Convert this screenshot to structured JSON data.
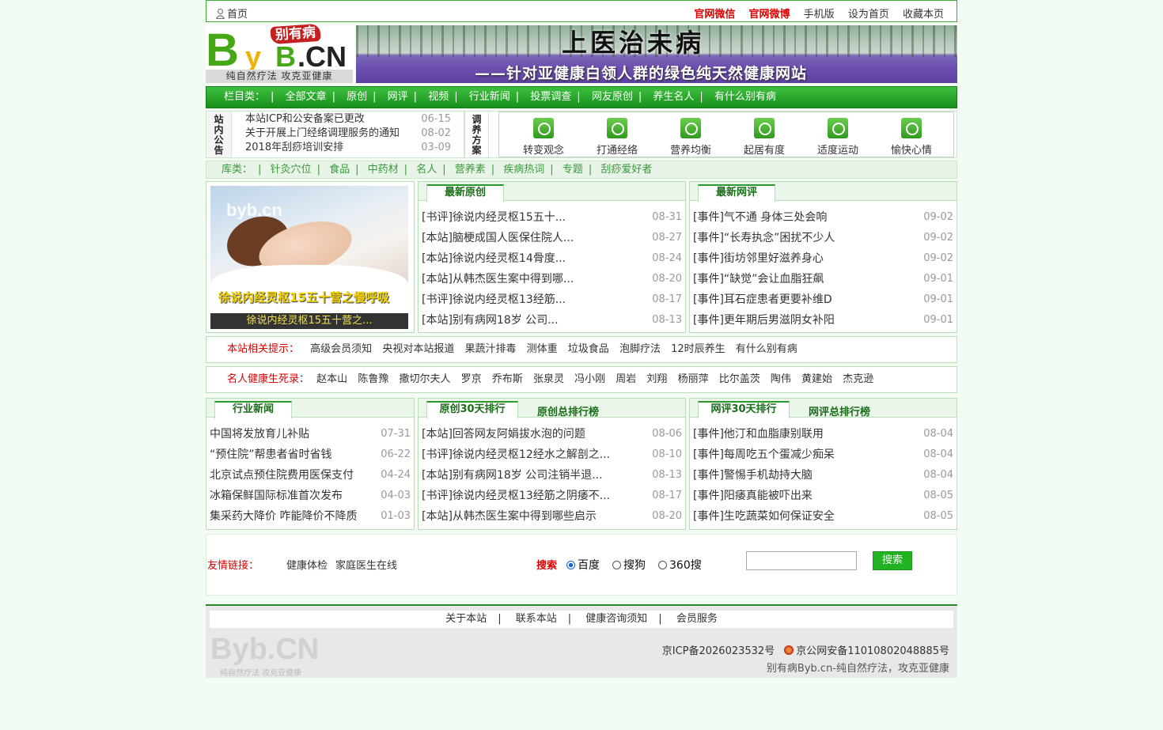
{
  "topbar": {
    "home": "首页",
    "links": [
      "官网微信",
      "官网微博",
      "手机版",
      "设为首页",
      "收藏本页"
    ]
  },
  "logo": {
    "b": "B",
    "y": "y",
    "b2": "B",
    "cn": ".CN",
    "calligraphy": "别有病",
    "slogan": "纯自然疗法 攻克亚健康"
  },
  "banner": {
    "title": "上医治未病",
    "subtitle": "——针对亚健康白领人群的绿色纯天然健康网站"
  },
  "nav": {
    "label": "栏目类：",
    "items": [
      "全部文章",
      "原创",
      "网评",
      "视频",
      "行业新闻",
      "投票调查",
      "网友原创",
      "养生名人",
      "有什么别有病"
    ]
  },
  "notice": {
    "label": "站内公告",
    "items": [
      {
        "title": "本站ICP和公安备案已更改",
        "date": "06-15"
      },
      {
        "title": "关于开展上门经络调理服务的通知",
        "date": "08-02"
      },
      {
        "title": "2018年刮痧培训安排",
        "date": "03-09"
      }
    ]
  },
  "plan": {
    "label": "调养方案",
    "items": [
      "转变观念",
      "打通经络",
      "营养均衡",
      "起居有度",
      "适度运动",
      "愉快心情"
    ]
  },
  "library": {
    "label": "库类：",
    "items": [
      "针灸穴位",
      "食品",
      "中药材",
      "名人",
      "营养素",
      "疾病热词",
      "专题",
      "刮痧爱好者"
    ]
  },
  "featured": {
    "watermark": "byb.cn",
    "image_caption": "徐说内经灵枢15五十营之慢呼吸",
    "title": "徐说内经灵枢15五十营之..."
  },
  "latest_original": {
    "tab": "最新原创",
    "items": [
      {
        "title": "[书评]徐说内经灵枢15五十...",
        "date": "08-31"
      },
      {
        "title": "[本站]脑梗成国人医保住院人...",
        "date": "08-27"
      },
      {
        "title": "[本站]徐说内经灵枢14骨度...",
        "date": "08-24"
      },
      {
        "title": "[本站]从韩杰医生案中得到哪...",
        "date": "08-20"
      },
      {
        "title": "[书评]徐说内经灵枢13经筋...",
        "date": "08-17"
      },
      {
        "title": "[本站]别有病网18岁 公司...",
        "date": "08-13"
      }
    ]
  },
  "latest_review": {
    "tab": "最新网评",
    "items": [
      {
        "title": "[事件]气不通 身体三处会响",
        "date": "09-02"
      },
      {
        "title": "[事件]“长寿执念”困扰不少人",
        "date": "09-02"
      },
      {
        "title": "[事件]街坊邻里好滋养身心",
        "date": "09-02"
      },
      {
        "title": "[事件]“缺觉”会让血脂狂飙",
        "date": "09-01"
      },
      {
        "title": "[事件]耳石症患者更要补维D",
        "date": "09-01"
      },
      {
        "title": "[事件]更年期后男滋阴女补阳",
        "date": "09-01"
      }
    ]
  },
  "tips": {
    "label": "本站相关提示：",
    "items": [
      "高级会员须知",
      "央视对本站报道",
      "果蔬汁排毒",
      "测体重",
      "垃圾食品",
      "泡脚疗法",
      "12时辰养生",
      "有什么别有病"
    ]
  },
  "celebrities": {
    "label": "名人健康生死录",
    "colon": "：",
    "items": [
      "赵本山",
      "陈鲁豫",
      "撒切尔夫人",
      "罗京",
      "乔布斯",
      "张泉灵",
      "冯小刚",
      "周岩",
      "刘翔",
      "杨丽萍",
      "比尔盖茨",
      "陶伟",
      "黄建始",
      "杰克逊"
    ]
  },
  "industry_news": {
    "tab": "行业新闻",
    "items": [
      {
        "title": "中国将发放育儿补贴",
        "date": "07-31"
      },
      {
        "title": "“预住院”帮患者省时省钱",
        "date": "06-22"
      },
      {
        "title": "北京试点预住院费用医保支付",
        "date": "04-24"
      },
      {
        "title": "冰箱保鲜国际标准首次发布",
        "date": "04-03"
      },
      {
        "title": "集采药大降价 咋能降价不降质",
        "date": "01-03"
      }
    ]
  },
  "original_rank": {
    "tab_active": "原创30天排行",
    "tab_other": "原创总排行榜",
    "items": [
      {
        "title": "[本站]回答网友阿娟拔水泡的问题",
        "date": "08-06"
      },
      {
        "title": "[书评]徐说内经灵枢12经水之解剖之...",
        "date": "08-10"
      },
      {
        "title": "[本站]别有病网18岁 公司注销半退...",
        "date": "08-13"
      },
      {
        "title": "[书评]徐说内经灵枢13经筋之阴痿不...",
        "date": "08-17"
      },
      {
        "title": "[本站]从韩杰医生案中得到哪些启示",
        "date": "08-20"
      }
    ]
  },
  "review_rank": {
    "tab_active": "网评30天排行",
    "tab_other": "网评总排行榜",
    "items": [
      {
        "title": "[事件]他汀和血脂康别联用",
        "date": "08-04"
      },
      {
        "title": "[事件]每周吃五个蛋减少痴呆",
        "date": "08-04"
      },
      {
        "title": "[事件]警惕手机劫持大脑",
        "date": "08-04"
      },
      {
        "title": "[事件]阳痿真能被吓出来",
        "date": "08-05"
      },
      {
        "title": "[事件]生吃蔬菜如何保证安全",
        "date": "08-05"
      }
    ]
  },
  "friends": {
    "label": "友情链接：",
    "links": [
      "健康体检",
      "家庭医生在线"
    ],
    "search_label": "搜索",
    "engines": [
      "百度",
      "搜狗",
      "360搜"
    ],
    "selected_engine": "百度",
    "search_value": "",
    "search_button": "搜索"
  },
  "footer": {
    "links": [
      "关于本站",
      "联系本站",
      "健康咨询须知",
      "会员服务"
    ],
    "separator": "|",
    "logo": "Byb.CN",
    "logo_slogan": "纯自然疗法 攻克亚健康",
    "icp": "京ICP备2026023532号",
    "police": "京公网安备11010802048885号",
    "motto": "别有病Byb.cn-纯自然疗法，攻克亚健康"
  },
  "colors": {
    "green": "#2a9a2a",
    "red": "#dd0000",
    "nav_green": "#16901a",
    "background": "#f2fcf2"
  }
}
